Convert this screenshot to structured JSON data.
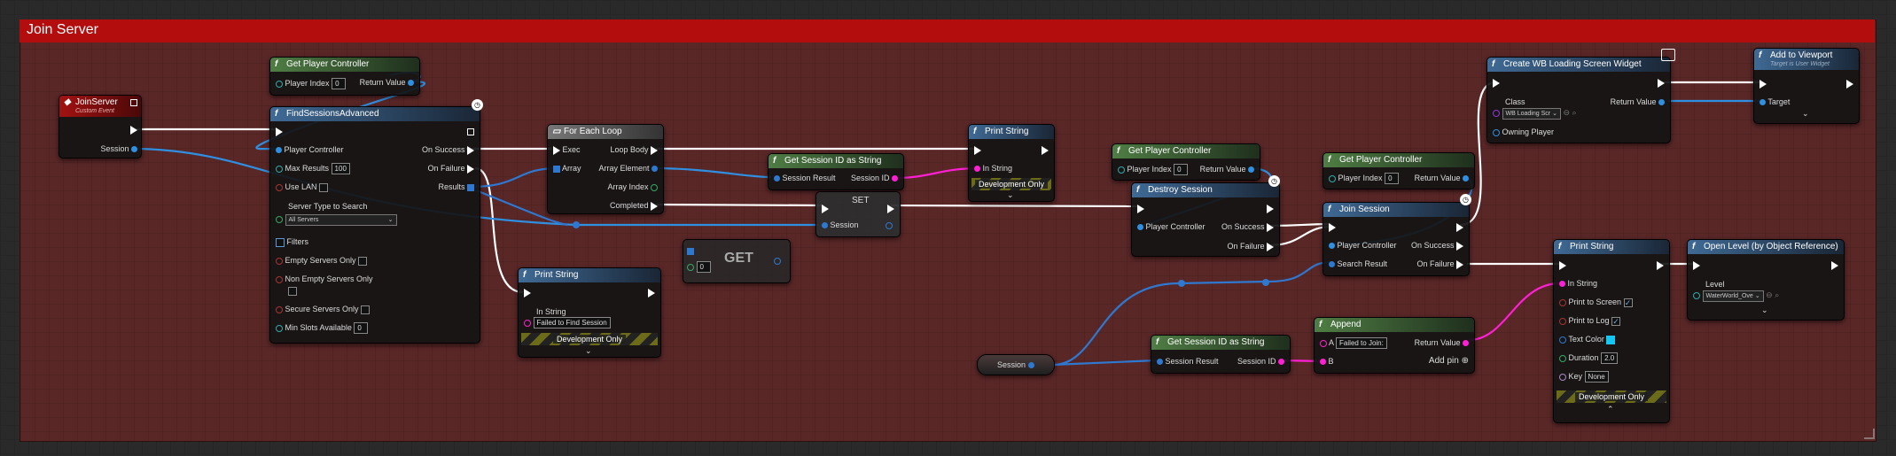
{
  "comment": {
    "title": "Join Server"
  },
  "nodes": {
    "join_server": {
      "title": "JoinServer",
      "subtitle": "Custom Event",
      "session": "Session"
    },
    "gpc1": {
      "title": "Get Player Controller",
      "player_index_label": "Player Index",
      "player_index": "0",
      "return_value": "Return Value"
    },
    "find_sessions": {
      "title": "FindSessionsAdvanced",
      "player_controller": "Player Controller",
      "max_results_label": "Max Results",
      "max_results": "100",
      "use_lan": "Use LAN",
      "server_type_label": "Server Type to Search",
      "server_type_value": "All Servers",
      "filters": "Filters",
      "empty_only": "Empty Servers Only",
      "non_empty_only": "Non Empty Servers Only",
      "secure_only": "Secure Servers Only",
      "min_slots_label": "Min Slots Available",
      "min_slots": "0",
      "on_success": "On Success",
      "on_failure": "On Failure",
      "results": "Results"
    },
    "foreach": {
      "title": "For Each Loop",
      "exec": "Exec",
      "array": "Array",
      "loop_body": "Loop Body",
      "array_element": "Array Element",
      "array_index": "Array Index",
      "completed": "Completed"
    },
    "get_node": {
      "title": "GET",
      "index": "0"
    },
    "print_fail": {
      "title": "Print String",
      "in_string_label": "In String",
      "in_string": "Failed to Find Session",
      "dev": "Development Only"
    },
    "get_sid1": {
      "title": "Get Session ID as String",
      "session_result": "Session Result",
      "session_id": "Session ID"
    },
    "set_node": {
      "title": "SET",
      "session": "Session"
    },
    "print2": {
      "title": "Print String",
      "in_string": "In String",
      "dev": "Development Only"
    },
    "gpc2": {
      "title": "Get Player Controller",
      "player_index_label": "Player Index",
      "player_index": "0",
      "return_value": "Return Value"
    },
    "destroy": {
      "title": "Destroy Session",
      "player_controller": "Player Controller",
      "on_success": "On Success",
      "on_failure": "On Failure"
    },
    "gpc3": {
      "title": "Get Player Controller",
      "player_index_label": "Player Index",
      "player_index": "0",
      "return_value": "Return Value"
    },
    "join_session": {
      "title": "Join Session",
      "player_controller": "Player Controller",
      "search_result": "Search Result",
      "on_success": "On Success",
      "on_failure": "On Failure"
    },
    "session_var": {
      "label": "Session"
    },
    "get_sid2": {
      "title": "Get Session ID as String",
      "session_result": "Session Result",
      "session_id": "Session ID"
    },
    "append": {
      "title": "Append",
      "a_label": "A",
      "a_value": "Failed to Join:",
      "b_label": "B",
      "return_value": "Return Value",
      "add_pin": "Add pin"
    },
    "create_widget": {
      "title": "Create WB Loading Screen Widget",
      "class_label": "Class",
      "class_value": "WB Loading Scr",
      "owning_player": "Owning Player",
      "return_value": "Return Value"
    },
    "add_viewport": {
      "title": "Add to Viewport",
      "subtitle": "Target is User Widget",
      "target": "Target"
    },
    "print3": {
      "title": "Print String",
      "in_string": "In String",
      "print_screen": "Print to Screen",
      "print_log": "Print to Log",
      "text_color": "Text Color",
      "duration_label": "Duration",
      "duration": "2.0",
      "key_label": "Key",
      "key": "None",
      "dev": "Development Only"
    },
    "open_level": {
      "title": "Open Level (by Object Reference)",
      "level_label": "Level",
      "level_value": "WaterWorld_Ove"
    }
  },
  "colors": {
    "exec": "#ffffff",
    "object": "#2f8fe0",
    "string": "#ff1fd4",
    "struct": "#2f78d0",
    "comment_bar": "#b30d0d",
    "comment_bg": "#5a2727",
    "text_color_value": "#15c7f0"
  }
}
